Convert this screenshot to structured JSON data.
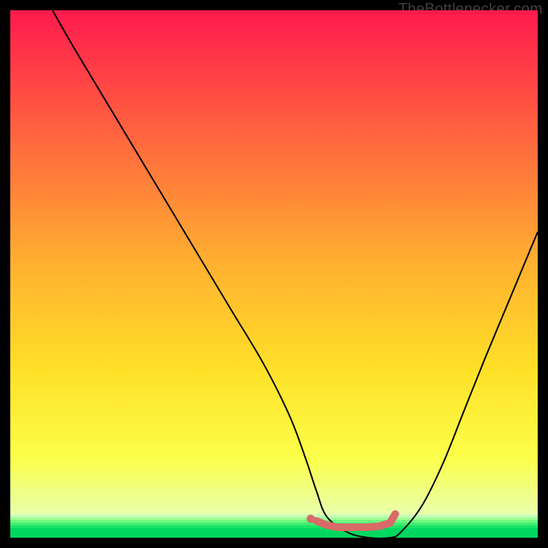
{
  "attribution": "TheBottlenecker.com",
  "colors": {
    "top": "#ff1a4d",
    "mid1": "#ff6040",
    "mid2": "#ffb030",
    "mid3": "#ffe028",
    "mid4": "#fbff4a",
    "bottom_fade": "#e8ffb0",
    "green": "#00d860",
    "curve": "#000000",
    "marker": "#d96a67"
  },
  "chart_data": {
    "type": "line",
    "title": "",
    "xlabel": "",
    "ylabel": "",
    "xlim": [
      0,
      100
    ],
    "ylim": [
      0,
      100
    ],
    "series": [
      {
        "name": "bottleneck-curve",
        "x": [
          8,
          12,
          18,
          24,
          30,
          36,
          42,
          48,
          53,
          56,
          58,
          60,
          64,
          68,
          72,
          74,
          78,
          82,
          86,
          90,
          95,
          100
        ],
        "y": [
          100,
          93,
          83,
          73,
          63,
          53,
          43,
          33,
          23,
          15,
          9,
          4,
          1,
          0,
          0,
          1,
          6,
          14,
          24,
          34,
          46,
          58
        ]
      }
    ],
    "markers": {
      "name": "optimal-range",
      "x": [
        58,
        60,
        62,
        64,
        66,
        68,
        70,
        72,
        73
      ],
      "y": [
        3.2,
        2.4,
        2.0,
        2.0,
        2.0,
        2.0,
        2.2,
        2.8,
        4.5
      ]
    }
  }
}
